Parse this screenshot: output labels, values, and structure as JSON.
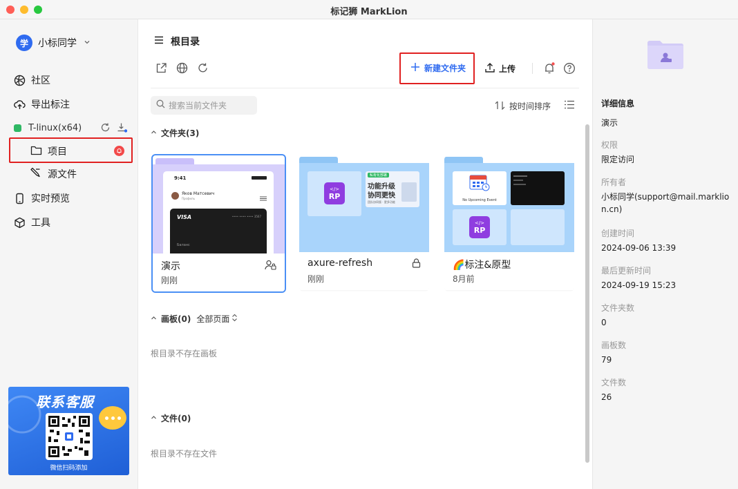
{
  "window": {
    "title": "标记狮 MarkLion"
  },
  "sidebar": {
    "user": {
      "avatar_text": "学",
      "name": "小标同学"
    },
    "nav": [
      {
        "label": "社区",
        "icon": "community-icon"
      },
      {
        "label": "导出标注",
        "icon": "export-icon"
      }
    ],
    "workspace": {
      "name": "T-linux(x64)"
    },
    "project_items": [
      {
        "label": "项目",
        "icon": "folder-icon"
      },
      {
        "label": "源文件",
        "icon": "source-file-icon"
      }
    ],
    "nav_bottom": [
      {
        "label": "实时预览",
        "icon": "phone-icon"
      },
      {
        "label": "工具",
        "icon": "cube-icon"
      }
    ],
    "promo": {
      "title": "联系客服",
      "caption": "微信扫码添加"
    }
  },
  "main": {
    "breadcrumb": "根目录",
    "new_folder_label": "新建文件夹",
    "upload_label": "上传",
    "search_placeholder": "搜索当前文件夹",
    "sort_label": "按时间排序",
    "folders_heading": "文件夹(3)",
    "folders": [
      {
        "name": "演示",
        "time": "刚刚",
        "access_icon": "shared-user-icon",
        "preview": {
          "clock": "9:41",
          "contact": "Яков Матсевич",
          "contact_sub": "Профиль",
          "card_brand": "VISA",
          "card_number": "•••• •••• •••• 3567",
          "balance_label": "Баланс"
        }
      },
      {
        "name": "axure-refresh",
        "time": "刚刚",
        "access_icon": "lock-icon",
        "preview": {
          "tag": "私有化部署",
          "headline1": "功能升级",
          "headline2": "协同更快",
          "sub": "团队协同版 · 更多功能"
        }
      },
      {
        "name": "🌈标注&原型",
        "time": "8月前",
        "access_icon": "",
        "preview": {
          "calendar_caption": "No Upcoming Event"
        }
      }
    ],
    "boards_heading": "画板(0)",
    "boards_filter": "全部页面",
    "boards_empty": "根目录不存在画板",
    "files_heading": "文件(0)",
    "files_empty": "根目录不存在文件"
  },
  "details": {
    "title": "详细信息",
    "name": "演示",
    "fields": [
      {
        "label": "权限",
        "value": "限定访问"
      },
      {
        "label": "所有者",
        "value": "小标同学(support@mail.marklion.cn)"
      },
      {
        "label": "创建时间",
        "value": "2024-09-06 13:39"
      },
      {
        "label": "最后更新时间",
        "value": "2024-09-19 15:23"
      },
      {
        "label": "文件夹数",
        "value": "0"
      },
      {
        "label": "画板数",
        "value": "79"
      },
      {
        "label": "文件数",
        "value": "26"
      }
    ]
  },
  "colors": {
    "accent": "#2f6bf0",
    "highlight": "#e02020",
    "folder": "#a9d4fb",
    "folder_selected": "#d7d0fb"
  }
}
